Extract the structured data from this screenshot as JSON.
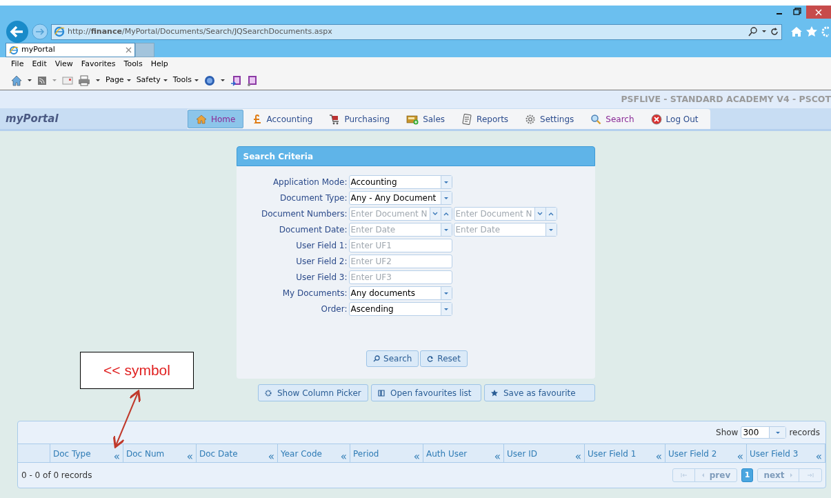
{
  "browser": {
    "url": "http://**finance**/MyPortal/Documents/Search/JQSearchDocuments.aspx",
    "tab_title": "myPortal",
    "menu": [
      "File",
      "Edit",
      "View",
      "Favorites",
      "Tools",
      "Help"
    ],
    "toolbar": [
      "Page",
      "Safety",
      "Tools"
    ]
  },
  "banner": "PSFLIVE - STANDARD ACADEMY V4 - PSCOT",
  "logo": "myPortal",
  "nav": [
    {
      "label": "Home",
      "selected": true,
      "visited": true
    },
    {
      "label": "Accounting",
      "selected": false,
      "visited": false
    },
    {
      "label": "Purchasing",
      "selected": false,
      "visited": false
    },
    {
      "label": "Sales",
      "selected": false,
      "visited": false
    },
    {
      "label": "Reports",
      "selected": false,
      "visited": false
    },
    {
      "label": "Settings",
      "selected": false,
      "visited": false
    },
    {
      "label": "Search",
      "selected": false,
      "visited": true
    },
    {
      "label": "Log Out",
      "selected": false,
      "visited": false
    }
  ],
  "search_panel": {
    "title": "Search Criteria",
    "fields": [
      {
        "label": "Application Mode:",
        "kind": "select",
        "value": "Accounting"
      },
      {
        "label": "Document Type:",
        "kind": "select",
        "value": "Any - Any Document"
      },
      {
        "label": "Document Numbers:",
        "kind": "spin-range",
        "placeholders": [
          "Enter Document N",
          "Enter Document N"
        ]
      },
      {
        "label": "Document Date:",
        "kind": "date-range",
        "placeholders": [
          "Enter Date",
          "Enter Date"
        ]
      },
      {
        "label": "User Field 1:",
        "kind": "text",
        "placeholder": "Enter UF1"
      },
      {
        "label": "User Field 2:",
        "kind": "text",
        "placeholder": "Enter UF2"
      },
      {
        "label": "User Field 3:",
        "kind": "text",
        "placeholder": "Enter UF3"
      },
      {
        "label": "My Documents:",
        "kind": "select",
        "value": "Any documents"
      },
      {
        "label": "Order:",
        "kind": "select",
        "value": "Ascending"
      }
    ],
    "buttons": [
      "Search",
      "Reset"
    ]
  },
  "actions": [
    "Show Column Picker",
    "Open favourites list",
    "Save as favourite"
  ],
  "annotation": "<< symbol",
  "grid": {
    "show_label": "Show",
    "page_size": "300",
    "records_label": "records",
    "columns": [
      {
        "label": "Doc Type",
        "sort": "«"
      },
      {
        "label": "Doc Num",
        "sort": "«"
      },
      {
        "label": "Doc Date",
        "sort": "«"
      },
      {
        "label": "Year Code",
        "sort": "«"
      },
      {
        "label": "Period",
        "sort": "«"
      },
      {
        "label": "Auth User",
        "sort": "«"
      },
      {
        "label": "User ID",
        "sort": "«"
      },
      {
        "label": "User Field 1",
        "sort": "«"
      },
      {
        "label": "User Field 2",
        "sort": "«"
      },
      {
        "label": "User Field 3",
        "sort": "«"
      }
    ],
    "summary": "0 - 0 of 0 records",
    "pager": {
      "prev": "prev",
      "next": "next",
      "pages": [
        {
          "label": "1",
          "selected": true
        }
      ]
    }
  }
}
